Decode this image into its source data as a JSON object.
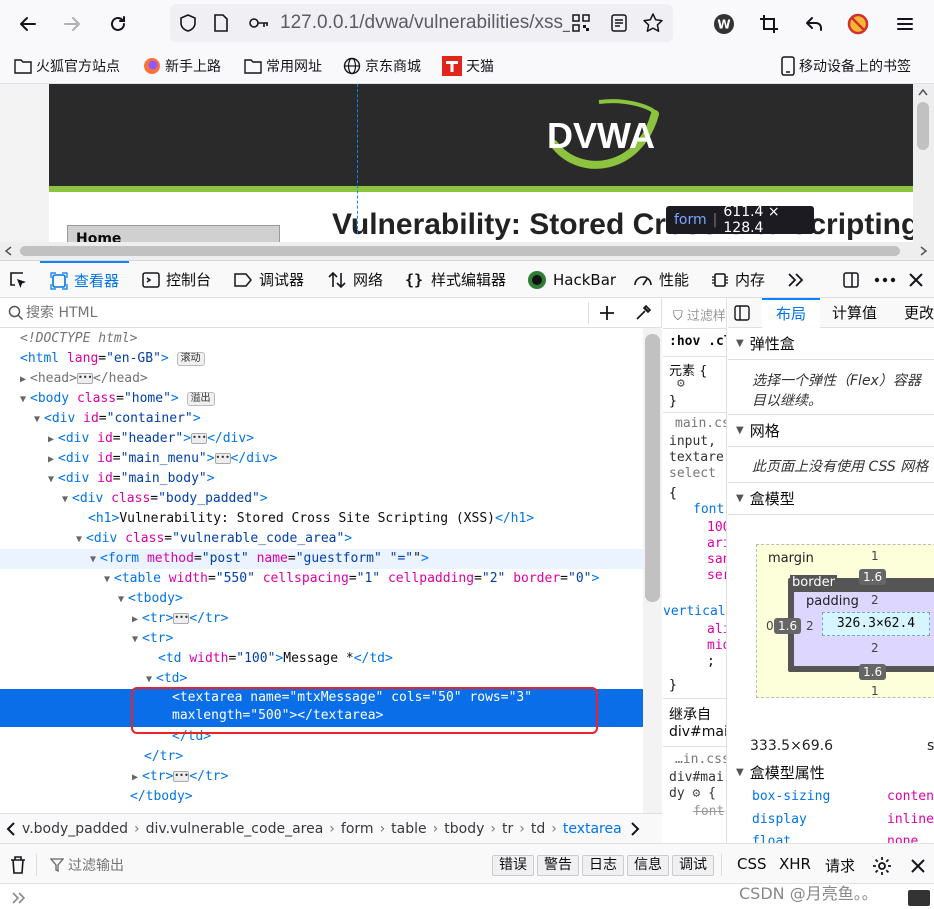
{
  "browser": {
    "url": "127.0.0.1/dvwa/vulnerabilities/xss_",
    "bookmarks": [
      "火狐官方站点",
      "新手上路",
      "常用网址",
      "京东商城",
      "天猫"
    ],
    "mobile_bookmarks": "移动设备上的书签"
  },
  "page": {
    "logo_text": "DVWA",
    "heading": "Vulnerability: Stored Cross Site Scripting (XSS)",
    "menu_home": "Home",
    "tooltip_tag": "form",
    "tooltip_size": "611.4 × 128.4"
  },
  "devtools": {
    "tabs": [
      "查看器",
      "控制台",
      "调试器",
      "网络",
      "样式编辑器",
      "HackBar",
      "性能",
      "内存"
    ],
    "search_placeholder": "搜索 HTML",
    "badges": {
      "scroll": "滚动",
      "overflow": "溢出"
    },
    "breadcrumbs": [
      "v.body_padded",
      "div.vulnerable_code_area",
      "form",
      "table",
      "tbody",
      "tr",
      "td",
      "textarea"
    ],
    "rules": {
      "filter": "过滤样",
      "hov": ":hov",
      "cls": ".cl",
      "element": "元素 {",
      "close": "}",
      "file": "main.cs",
      "selector1": "input,",
      "selector2": "textare",
      "selector3": "select",
      "open": "{",
      "prop_font": "font",
      "val1": "100",
      "val2": "ari",
      "val3": "san",
      "val4": "ser",
      "prop_vertical": "vertical",
      "val5": "ali",
      "val6": "mid",
      "semicolon": ";",
      "inherited": "继承自",
      "inherited_from": "div#mai",
      "file2": "…in.css",
      "sel4": "div#mai",
      "sel5": "dy",
      "font_strike": "font"
    },
    "layout": {
      "tabs": [
        "布局",
        "计算值",
        "更改"
      ],
      "flex_title": "弹性盒",
      "flex_msg1": "选择一个弹性（Flex）容器",
      "flex_msg2": "目以继续。",
      "grid_title": "网格",
      "grid_msg": "此页面上没有使用 CSS 网格",
      "boxmodel_title": "盒模型",
      "margin_label": "margin",
      "border_label": "border",
      "padding_label": "padding",
      "margin_top": "1",
      "margin_bottom": "1",
      "margin_left": "0",
      "border_top": "1.6",
      "border_bottom": "1.6",
      "border_left": "1.6",
      "padding_top": "2",
      "padding_bottom": "2",
      "padding_left": "2",
      "content_size": "326.3×62.4",
      "dimension": "333.5×69.6",
      "dimension_suffix": "s",
      "props_title": "盒模型属性",
      "props": [
        {
          "key": "box-sizing",
          "value": "conten"
        },
        {
          "key": "display",
          "value": "inline"
        },
        {
          "key": "float",
          "value": "none"
        }
      ]
    },
    "console": {
      "filter_placeholder": "过滤输出",
      "levels": [
        "错误",
        "警告",
        "日志",
        "信息",
        "调试"
      ],
      "right": [
        "CSS",
        "XHR",
        "请求"
      ]
    }
  },
  "watermark": "CSDN @月亮鱼。。"
}
